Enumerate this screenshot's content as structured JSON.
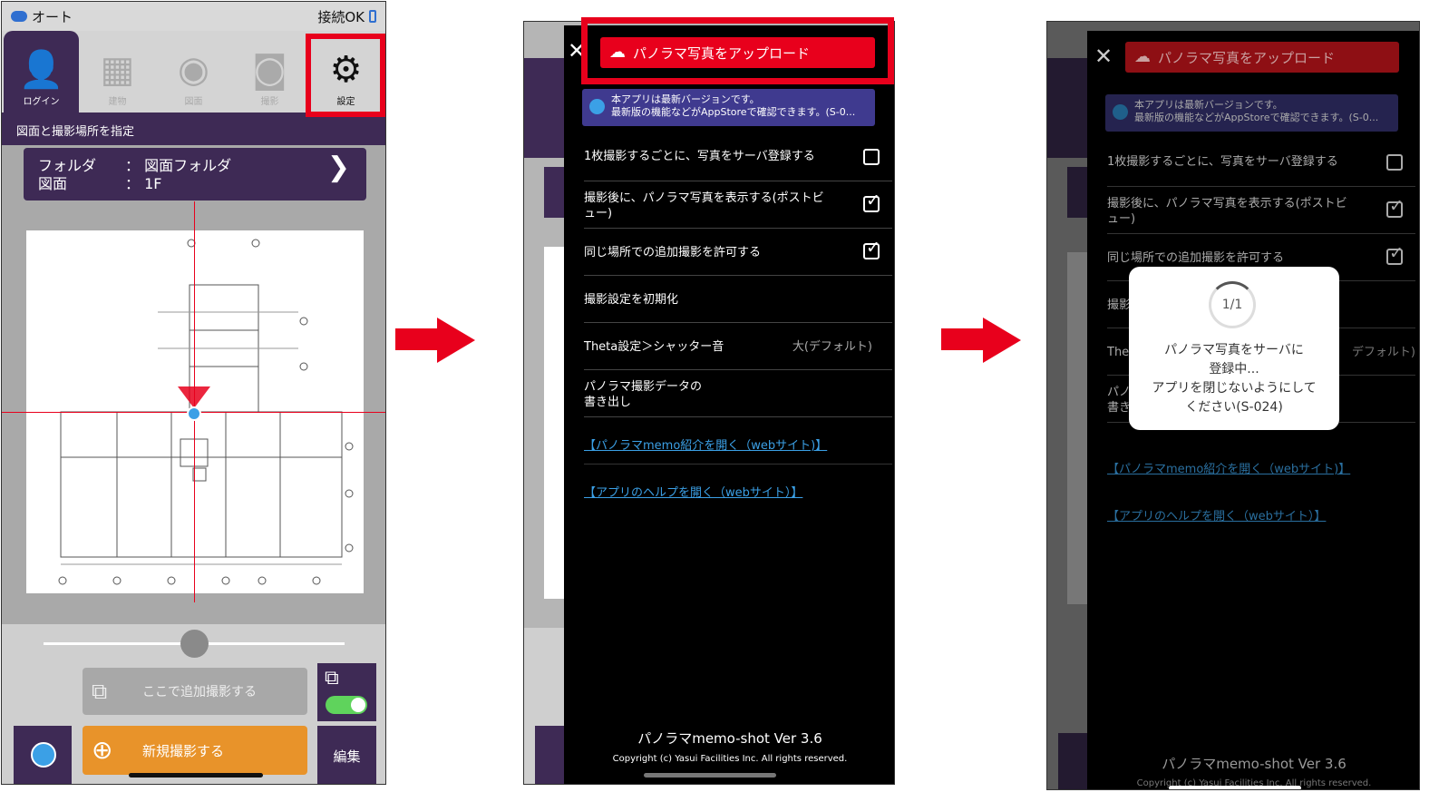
{
  "screen1": {
    "status": {
      "left": "オート",
      "right": "接続OK"
    },
    "tabs": [
      "ログイン",
      "建物",
      "図面",
      "撮影",
      "設定"
    ],
    "subtitle": "図面と撮影場所を指定",
    "folder": {
      "folder_label": "フォルダ",
      "folder_value": "図面フォルダ",
      "plan_label": "図面",
      "plan_value": "1F",
      "sep": "："
    },
    "add_button": "ここで追加撮影する",
    "new_button": "新規撮影する",
    "edit_button": "編集"
  },
  "menu": {
    "upload_button": "パノラマ写真をアップロード",
    "version_line1": "本アプリは最新バージョンです。",
    "version_line2": "最新版の機能などがAppStoreで確認できます。(S-0...",
    "rows": [
      {
        "label": "1枚撮影するごとに、写真をサーバ登録する",
        "checked": false
      },
      {
        "label": "撮影後に、パノラマ写真を表示する(ポストビュー)",
        "checked": true
      },
      {
        "label": "同じ場所での追加撮影を許可する",
        "checked": true
      },
      {
        "label": "撮影設定を初期化"
      },
      {
        "label": "Theta設定＞シャッター音",
        "value": "大(デフォルト)"
      },
      {
        "label": "パノラマ撮影データの書き出し"
      }
    ],
    "link1": "【パノラマmemo紹介を開く（webサイト)】",
    "link2": "【アプリのヘルプを開く（webサイト）】",
    "version": "パノラマmemo-shot Ver 3.6",
    "copyright": "Copyright (c) Yasui Facilities Inc. All rights reserved."
  },
  "screen3": {
    "peek_close": "✕",
    "progress": "1/1",
    "dialog_line1": "パノラマ写真をサーバに",
    "dialog_line2": "登録中...",
    "dialog_line3": "アプリを閉じないようにして",
    "dialog_line4": "ください(S-024)",
    "row_partial_1": "撮影",
    "row_partial_2": "The",
    "row_partial_2_val": "デフォルト)",
    "row_partial_3a": "パノ",
    "row_partial_3b": "書き"
  },
  "colors": {
    "accent": "#e8001c",
    "nav": "#3e2a55",
    "orange": "#e8932a",
    "link": "#3ba0e6"
  }
}
